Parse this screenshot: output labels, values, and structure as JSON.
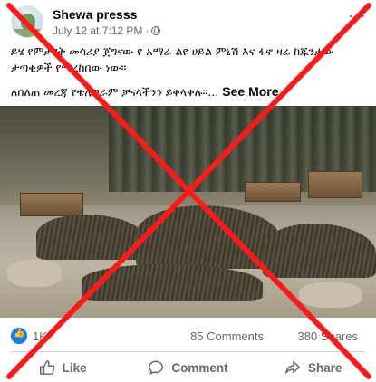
{
  "post": {
    "page_name": "Shewa presss",
    "timestamp": "July 12 at 7:12 PM",
    "separator": "·",
    "text_line1": "ይሄ የምታዩት መሳሪያ ጀግናው የ አማራ ልዩ ሀይል ምኒሽ እና ፋኖ ዛሬ ከጁንታው ታጣቂዎች የማረከበው ነው።",
    "text_line2": "ለበለጠ መረጃ የቴሌግራም ቻናላችንን ይቀላቀሉ።...",
    "see_more_label": "See More",
    "more_options": "···"
  },
  "reactions": {
    "count": "1K",
    "comments": "85 Comments",
    "shares": "380 Shares"
  },
  "actions": {
    "like": "Like",
    "comment": "Comment",
    "share": "Share"
  },
  "colors": {
    "cross": "#ff1a1a",
    "accent": "#1877f2",
    "secondary_text": "#65676b"
  },
  "icons": [
    "globe-icon",
    "like-icon",
    "comment-icon",
    "share-icon",
    "more-options-icon",
    "like-reaction-icon"
  ]
}
